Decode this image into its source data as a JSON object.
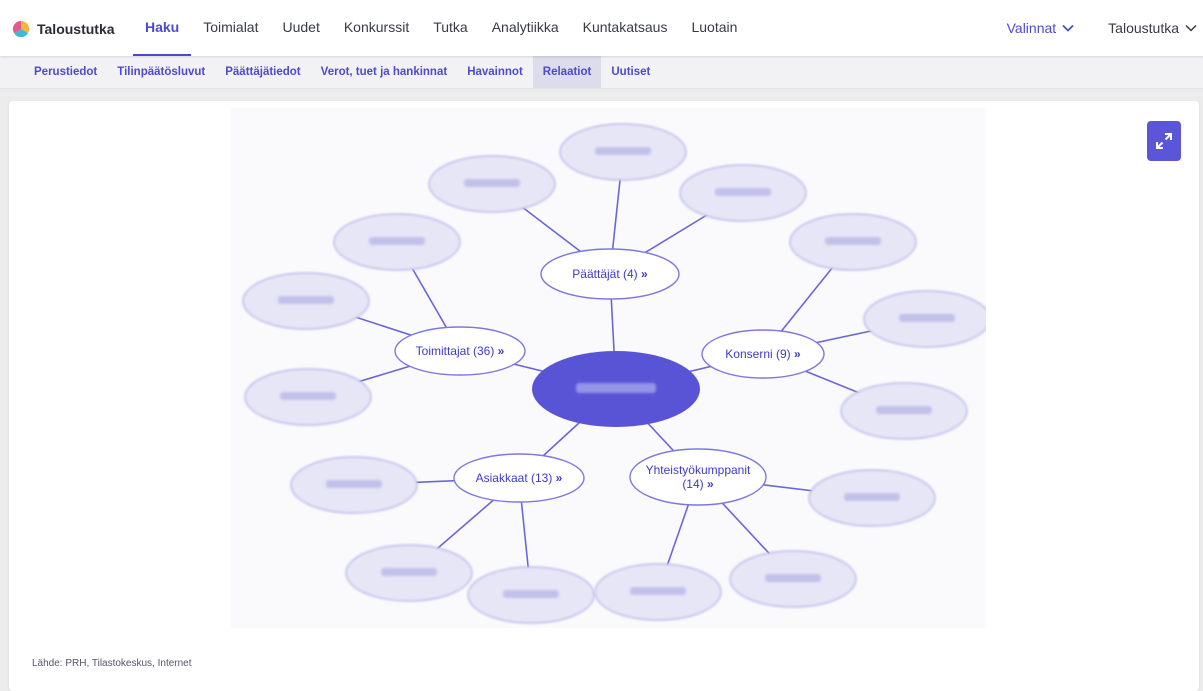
{
  "brand": {
    "name": "Taloustutka"
  },
  "top_nav": {
    "items": [
      {
        "label": "Haku",
        "active": true
      },
      {
        "label": "Toimialat",
        "active": false
      },
      {
        "label": "Uudet",
        "active": false
      },
      {
        "label": "Konkurssit",
        "active": false
      },
      {
        "label": "Tutka",
        "active": false
      },
      {
        "label": "Analytiikka",
        "active": false
      },
      {
        "label": "Kuntakatsaus",
        "active": false
      },
      {
        "label": "Luotain",
        "active": false
      }
    ],
    "valinnat_label": "Valinnat",
    "account_label": "Taloustutka"
  },
  "sub_nav": {
    "items": [
      {
        "label": "Perustiedot",
        "active": false
      },
      {
        "label": "Tilinpäätösluvut",
        "active": false
      },
      {
        "label": "Päättäjätiedot",
        "active": false
      },
      {
        "label": "Verot, tuet ja hankinnat",
        "active": false
      },
      {
        "label": "Havainnot",
        "active": false
      },
      {
        "label": "Relaatiot",
        "active": true
      },
      {
        "label": "Uutiset",
        "active": false
      }
    ]
  },
  "graph": {
    "groups": [
      {
        "label": "Päättäjät (4)"
      },
      {
        "label": "Toimittajat (36)"
      },
      {
        "label": "Konserni (9)"
      },
      {
        "label": "Asiakkaat (13)"
      },
      {
        "label": "Yhteistyökumppanit",
        "label_line2": "(14)"
      }
    ],
    "more_glyph": "»"
  },
  "expand_button": {
    "icon": "expand-arrows-icon"
  },
  "source_text": "Lähde: PRH, Tilastokeskus, Internet",
  "colors": {
    "accent": "#4e4ad0",
    "center_node": "#5954d6",
    "leaf_fill": "#e6e6f6",
    "leaf_stroke": "#b9b6ea",
    "edge": "#6b66d9"
  }
}
